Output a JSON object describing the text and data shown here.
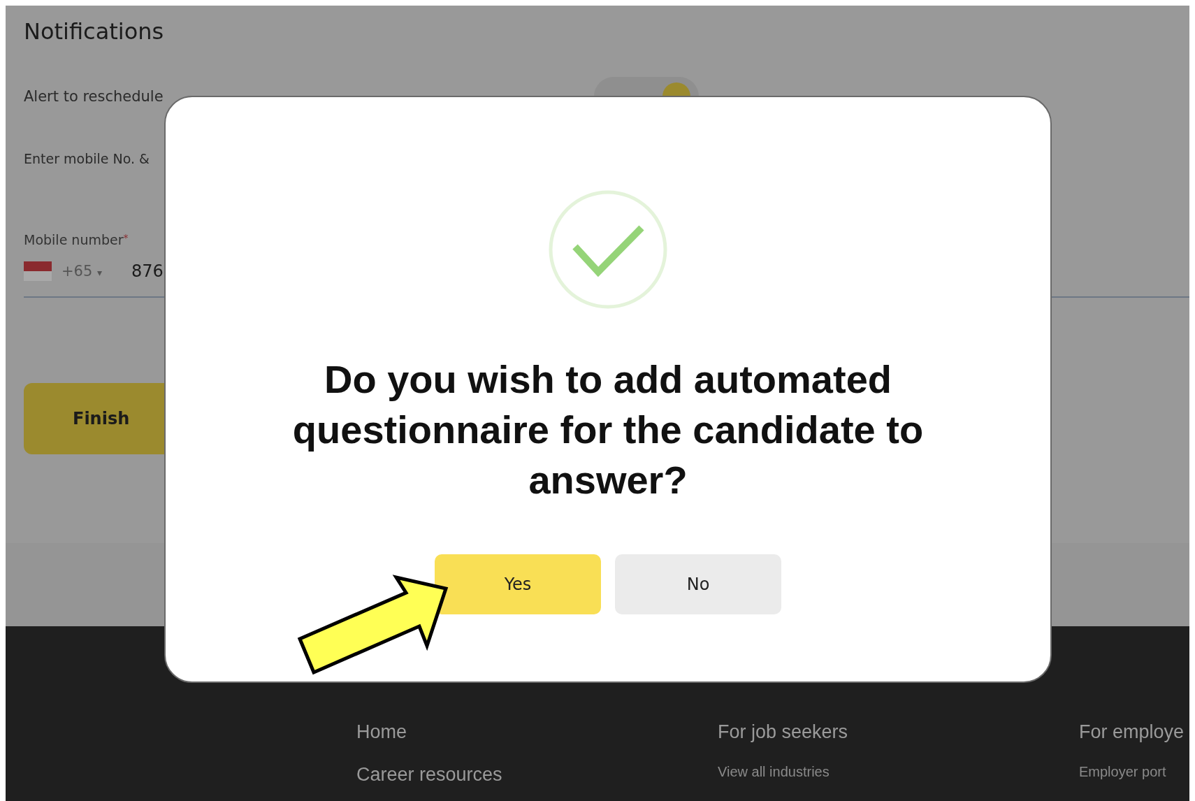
{
  "page": {
    "section_title": "Notifications",
    "alert_label": "Alert to reschedule",
    "alert_toggle": {
      "on": true
    },
    "mobile_hint": "Enter mobile No. &",
    "mobile_field": {
      "label": "Mobile number",
      "required_mark": "*",
      "country_code": "+65",
      "caret": "▾",
      "value": "876"
    },
    "finish_button": "Finish"
  },
  "dialog": {
    "message": "Do you wish to add automated questionnaire for the candidate to answer?",
    "buttons": [
      {
        "label": "Yes",
        "kind": "primary"
      },
      {
        "label": "No",
        "kind": "secondary"
      }
    ]
  },
  "footer": {
    "columns": [
      {
        "items": [
          {
            "text": "Home",
            "kind": "heading"
          },
          {
            "text": "Career resources",
            "kind": "heading"
          }
        ]
      },
      {
        "items": [
          {
            "text": "For job seekers",
            "kind": "heading"
          },
          {
            "text": "View all industries",
            "kind": "link"
          }
        ]
      },
      {
        "items": [
          {
            "text": "For employe",
            "kind": "heading"
          },
          {
            "text": "Employer port",
            "kind": "link"
          }
        ]
      }
    ]
  }
}
